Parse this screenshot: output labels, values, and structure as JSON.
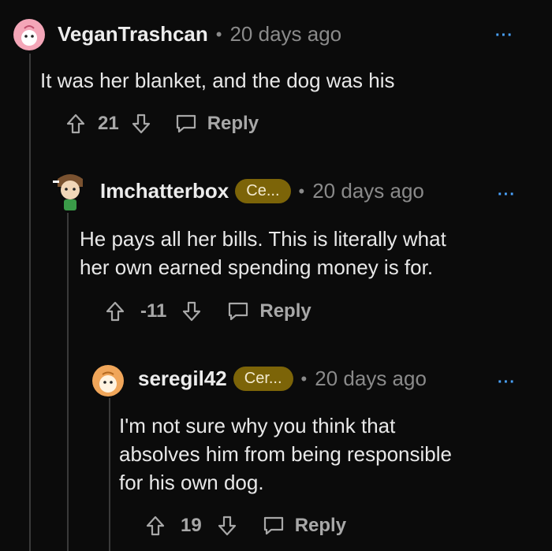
{
  "comments": [
    {
      "username": "VeganTrashcan",
      "flair": "",
      "separator": "•",
      "time": "20 days ago",
      "more": "···",
      "text": "It was her blanket, and the dog was his",
      "score": "21",
      "reply_label": "Reply"
    },
    {
      "username": "Imchatterbox",
      "flair": "Ce...",
      "separator": "•",
      "time": "20 days ago",
      "more": "···",
      "text_lines": [
        "He pays all her bills. This is literally what",
        "her own earned spending money is for."
      ],
      "score": "-11",
      "reply_label": "Reply"
    },
    {
      "username": "seregil42",
      "flair": "Cer...",
      "separator": "•",
      "time": "20 days ago",
      "more": "···",
      "text_lines": [
        "I'm not sure why you think that",
        "absolves him from being responsible",
        "for his own dog."
      ],
      "score": "19",
      "reply_label": "Reply"
    }
  ],
  "colors": {
    "background": "#0b0b0b",
    "flair": "#7c6408",
    "more": "#4aa3ff",
    "meta": "#8a8a8a"
  },
  "icons": [
    "upvote-icon",
    "downvote-icon",
    "comment-bubble-icon",
    "avatar"
  ]
}
